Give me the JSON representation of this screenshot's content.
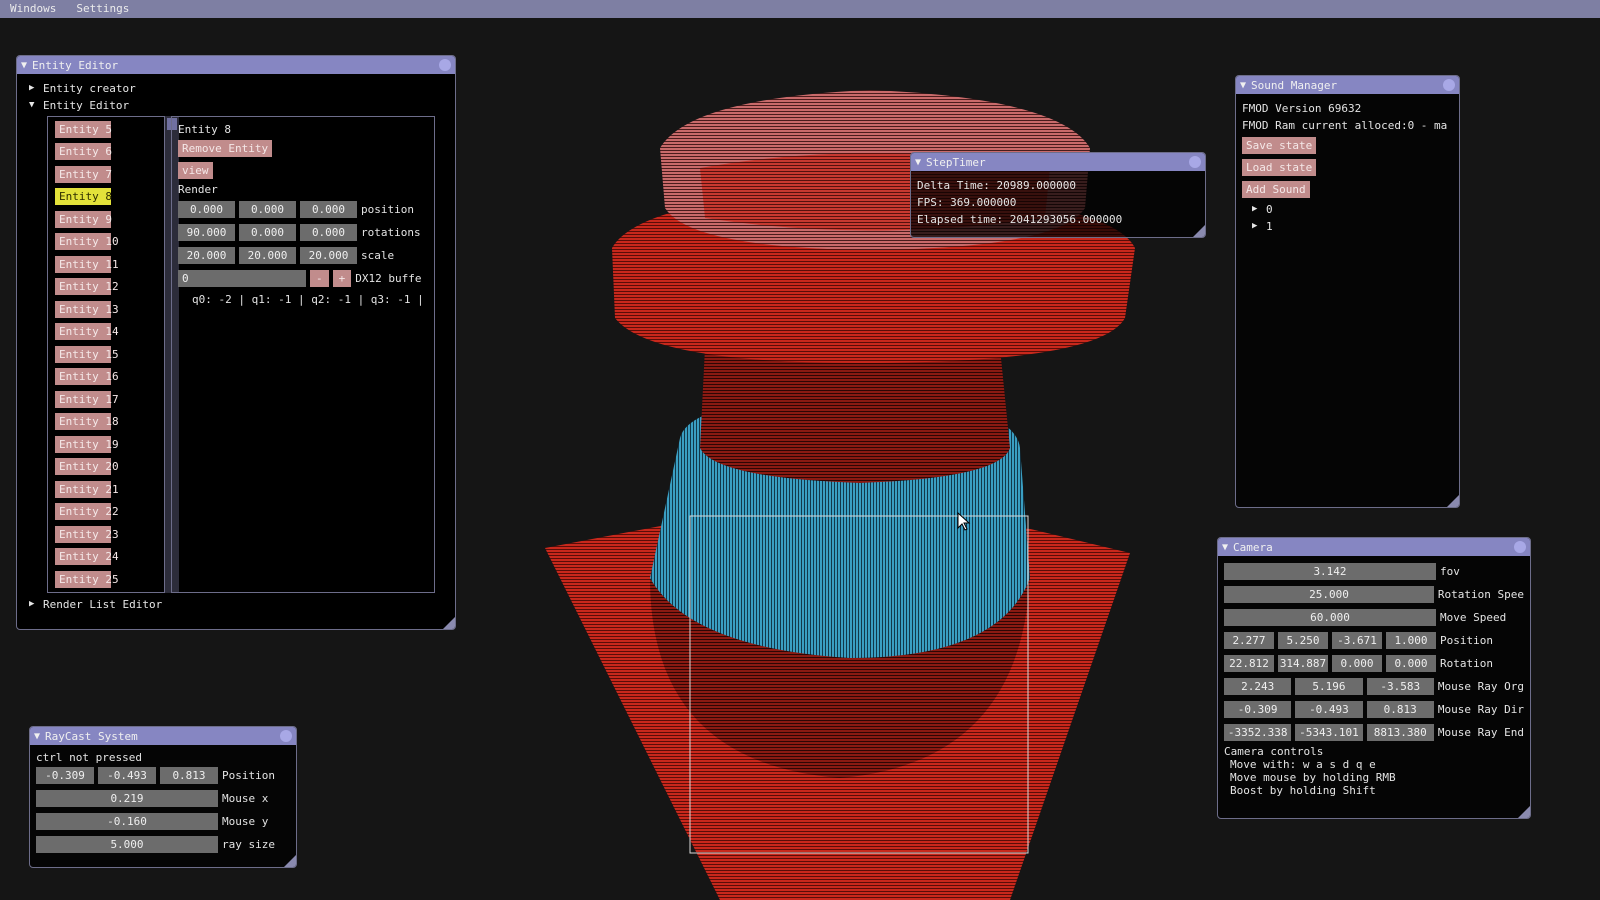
{
  "menubar": {
    "items": [
      "Windows",
      "Settings"
    ]
  },
  "entity_editor": {
    "title": "Entity Editor",
    "tree": {
      "creator": "Entity creator",
      "editor": "Entity Editor",
      "render_list": "Render List Editor"
    },
    "entities": [
      "Entity 5",
      "Entity 6",
      "Entity 7",
      "Entity 8",
      "Entity 9",
      "Entity 10",
      "Entity 11",
      "Entity 12",
      "Entity 13",
      "Entity 14",
      "Entity 15",
      "Entity 16",
      "Entity 17",
      "Entity 18",
      "Entity 19",
      "Entity 20",
      "Entity 21",
      "Entity 22",
      "Entity 23",
      "Entity 24",
      "Entity 25"
    ],
    "selected": "Entity 8",
    "detail": {
      "heading": "Entity 8",
      "remove_label": "Remove Entity",
      "view_label": "view",
      "render_label": "Render",
      "position": [
        "0.000",
        "0.000",
        "0.000"
      ],
      "position_label": "position",
      "rotations": [
        "90.000",
        "0.000",
        "0.000"
      ],
      "rotations_label": "rotations",
      "scale": [
        "20.000",
        "20.000",
        "20.000"
      ],
      "scale_label": "scale",
      "dx12_value": "0",
      "minus_label": "-",
      "plus_label": "+",
      "dx12_label": "DX12 buffe",
      "queues": "q0: -2 | q1: -1 | q2: -1 | q3: -1 |"
    }
  },
  "sound_manager": {
    "title": "Sound Manager",
    "version": "FMOD Version 69632",
    "ram": "FMOD Ram current alloced:0 - ma",
    "save_label": "Save state",
    "load_label": "Load state",
    "add_label": "Add Sound",
    "items": [
      "0",
      "1"
    ]
  },
  "step_timer": {
    "title": "StepTimer",
    "delta": "Delta Time: 20989.000000",
    "fps": "FPS: 369.000000",
    "elapsed": "Elapsed time: 2041293056.000000"
  },
  "camera": {
    "title": "Camera",
    "fov": "3.142",
    "fov_label": "fov",
    "rotation_speed": "25.000",
    "rotation_speed_label": "Rotation Spee",
    "move_speed": "60.000",
    "move_speed_label": "Move Speed",
    "position": [
      "2.277",
      "5.250",
      "-3.671",
      "1.000"
    ],
    "position_label": "Position",
    "rotation": [
      "22.812",
      "314.887",
      "0.000",
      "0.000"
    ],
    "rotation_label": "Rotation",
    "ray_org": [
      "2.243",
      "5.196",
      "-3.583"
    ],
    "ray_org_label": "Mouse Ray Org",
    "ray_dir": [
      "-0.309",
      "-0.493",
      "0.813"
    ],
    "ray_dir_label": "Mouse Ray Dir",
    "ray_end": [
      "-3352.338",
      "-5343.101",
      "8813.380"
    ],
    "ray_end_label": "Mouse Ray End",
    "controls_heading": "Camera controls",
    "controls": [
      "Move with: w a s d q e",
      "Move mouse by holding RMB",
      "Boost by holding Shift"
    ]
  },
  "raycast": {
    "title": "RayCast System",
    "status": "ctrl not pressed",
    "position": [
      "-0.309",
      "-0.493",
      "0.813"
    ],
    "position_label": "Position",
    "mouse_x": "0.219",
    "mouse_x_label": "Mouse x",
    "mouse_y": "-0.160",
    "mouse_y_label": "Mouse y",
    "ray_size": "5.000",
    "ray_size_label": "ray size"
  },
  "colors": {
    "titlebar": "#8686c2",
    "button": "#c18c8c",
    "button_active": "#e3e23a",
    "field": "#6c6c6c",
    "menubar": "#7e7fa3",
    "model_red": "#c8281c",
    "model_blue": "#3a9ec2"
  }
}
